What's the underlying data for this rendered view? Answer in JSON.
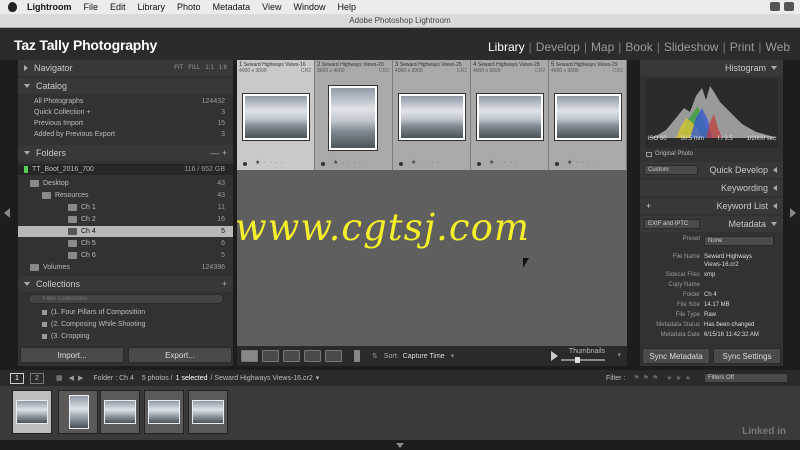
{
  "menubar": {
    "app": "Lightroom",
    "items": [
      "File",
      "Edit",
      "Library",
      "Photo",
      "Metadata",
      "View",
      "Window",
      "Help"
    ]
  },
  "window_title": "Adobe Photoshop Lightroom",
  "identity_plate": "Taz Tally Photography",
  "modules": [
    "Library",
    "Develop",
    "Map",
    "Book",
    "Slideshow",
    "Print",
    "Web"
  ],
  "active_module": "Library",
  "left": {
    "navigator": {
      "label": "Navigator",
      "zoom": [
        "FIT",
        "FILL",
        "1:1",
        "1:8"
      ]
    },
    "catalog": {
      "label": "Catalog",
      "items": [
        {
          "label": "All Photographs",
          "count": "124432"
        },
        {
          "label": "Quick Collection +",
          "count": "3"
        },
        {
          "label": "Previous Import",
          "count": "15"
        },
        {
          "label": "Added by Previous Export",
          "count": "3"
        }
      ]
    },
    "folders": {
      "label": "Folders",
      "volume": {
        "label": "TT_Boot_2016_700",
        "size": "116 / 652 GB"
      },
      "items": [
        {
          "label": "Desktop",
          "count": "43"
        },
        {
          "label": "Resources",
          "count": "43"
        },
        {
          "label": "Ch 1",
          "count": "11"
        },
        {
          "label": "Ch 2",
          "count": "16"
        },
        {
          "label": "Ch 4",
          "count": "5"
        },
        {
          "label": "Ch 5",
          "count": "6"
        },
        {
          "label": "Ch 6",
          "count": "5"
        },
        {
          "label": "Volumes",
          "count": "124396"
        }
      ]
    },
    "collections": {
      "label": "Collections",
      "filter_placeholder": "Filter Collections",
      "items": [
        "(1. Four Pillars of Composition",
        "(2. Composing While Shooting",
        "(3. Cropping"
      ]
    },
    "import_label": "Import...",
    "export_label": "Export..."
  },
  "grid": {
    "cells": [
      {
        "idx": "1",
        "name": "Seward Highways Views-16",
        "dim": "4000 x 3000",
        "ext": "CR2"
      },
      {
        "idx": "2",
        "name": "Seward Highways Views-20",
        "dim": "3000 x 4000",
        "ext": "CR2"
      },
      {
        "idx": "3",
        "name": "Seward Highways Views-25",
        "dim": "4000 x 3000",
        "ext": "CR2"
      },
      {
        "idx": "4",
        "name": "Seward Highways Views-28",
        "dim": "4000 x 3000",
        "ext": "CR2"
      },
      {
        "idx": "5",
        "name": "Seward Highways Views-29",
        "dim": "4000 x 3000",
        "ext": "CR2"
      }
    ],
    "stars": "★ · · · ·"
  },
  "toolbar": {
    "sort_label": "Sort:",
    "sort_value": "Capture Time",
    "thumbnails_label": "Thumbnails",
    "thumb_slider": 0.35
  },
  "watermark": "www.cgtsj.com",
  "right": {
    "histogram": {
      "label": "Histogram",
      "iso": "ISO 80",
      "focal": "30.5 mm",
      "aperture": "f / 3.5",
      "shutter": "1/2000 sec",
      "original": "Original Photo"
    },
    "quick_develop": {
      "label": "Quick Develop",
      "preset": "Custom"
    },
    "keywording": "Keywording",
    "keyword_list": "Keyword List",
    "metadata": {
      "label": "Metadata",
      "set": "EXIF and IPTC",
      "preset_label": "Preset",
      "preset_value": "None",
      "rows": [
        {
          "k": "File Name",
          "v": "Seward Highways"
        },
        {
          "k": "",
          "v": "Views-16.cr2"
        },
        {
          "k": "Sidecar Files",
          "v": "xmp"
        },
        {
          "k": "Copy Name",
          "v": ""
        },
        {
          "k": "Folder",
          "v": "Ch 4"
        },
        {
          "k": "File Size",
          "v": "14.17 MB"
        },
        {
          "k": "File Type",
          "v": "Raw"
        },
        {
          "k": "Metadata Status",
          "v": "Has been changed"
        },
        {
          "k": "Metadata Date",
          "v": "6/15/16 11:42:32 AM"
        }
      ]
    },
    "sync_metadata": "Sync Metadata",
    "sync_settings": "Sync Settings"
  },
  "filmbar": {
    "page1": "1",
    "page2": "2",
    "folder": "Folder : Ch 4",
    "count": "5 photos /",
    "selected": "1 selected",
    "file": "/ Seward Highways Views-16.cr2",
    "filter_label": "Filter :",
    "filter_value": "Filters Off"
  },
  "linkedin": "Linked in"
}
